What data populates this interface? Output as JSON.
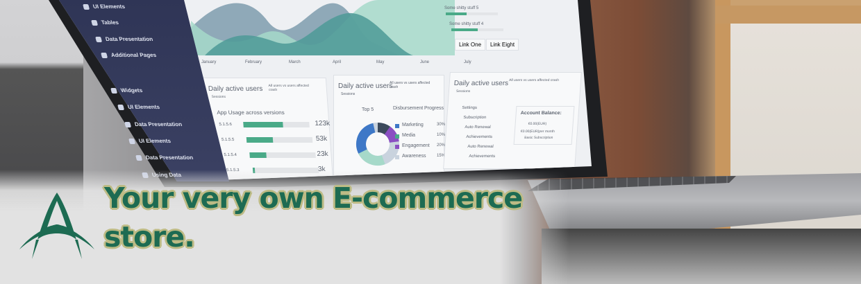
{
  "headline": {
    "line1": "Your very own E-commerce",
    "line2": "store."
  },
  "colors": {
    "headline_fill": "#1d6b52",
    "headline_outline": "#bdbb85",
    "logo": "#1d6b52",
    "accent_green": "#4aaa88"
  },
  "dashboard": {
    "sidebar": [
      "UI Elements",
      "Tables",
      "Data Presentation",
      "Additional Pages",
      "Widgets",
      "UI Elements",
      "Data Presentation",
      "UI Elements",
      "Data Presentation",
      "Using Data"
    ],
    "chart_months": [
      "January",
      "February",
      "March",
      "April",
      "May",
      "June",
      "July"
    ],
    "side_stats": [
      "Some shitty stuff 5",
      "Some shitty stuff 4"
    ],
    "links": [
      "Link One",
      "Link Eight"
    ],
    "card1": {
      "title": "Daily active users",
      "subtitle": "Sessions",
      "note": "All users vs users affected crash",
      "heading": "App Usage across versions",
      "rows": [
        {
          "label": "5.1.5.6",
          "value": "123k",
          "pct": 0.6
        },
        {
          "label": "5.1.5.5",
          "value": "53k",
          "pct": 0.4
        },
        {
          "label": "5.1.5.4",
          "value": "23k",
          "pct": 0.25
        },
        {
          "label": "5.1.5.3",
          "value": "3k",
          "pct": 0.03
        }
      ]
    },
    "card2": {
      "title": "Daily active users",
      "subtitle": "Sessions",
      "note": "All users vs users affected crash",
      "cols": [
        "Top 5",
        "Disbursement",
        "Progress"
      ],
      "legend": [
        {
          "label": "Marketing",
          "value": "30%",
          "color": "#3e78c7"
        },
        {
          "label": "Media",
          "value": "10%",
          "color": "#4aaa88"
        },
        {
          "label": "Engagement",
          "value": "20%",
          "color": "#8a4fc2"
        },
        {
          "label": "Awareness",
          "value": "15%",
          "color": "#c9d3de"
        }
      ]
    },
    "card3": {
      "title": "Daily active users",
      "subtitle": "Sessions",
      "note": "All users vs users affected crash",
      "menu": [
        "Settings",
        "Subscription",
        "Auto Renewal",
        "Achievements",
        "Auto Renewal",
        "Achievements"
      ],
      "balance_title": "Account Balance:",
      "balance_lines": [
        "€0.00(EUR)",
        "€0.00(EUR)per month",
        "Basic Subscription"
      ]
    }
  }
}
